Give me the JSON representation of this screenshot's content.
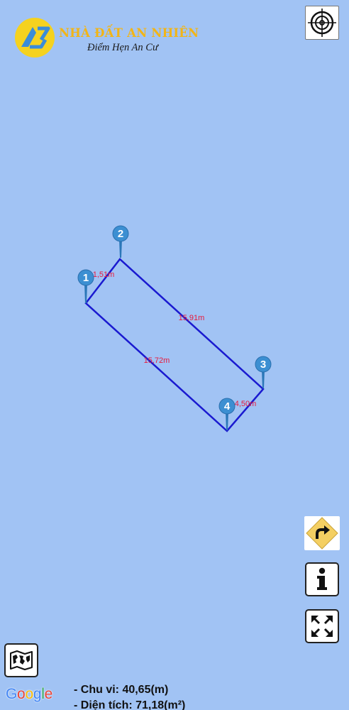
{
  "brand": {
    "name": "NHÀ ĐẤT AN NHIÊN",
    "slogan": "Điểm Hẹn An Cư",
    "logo_icon": "an-nhien-logo",
    "colors": {
      "circle": "#f5d21f",
      "mark": "#3a8cd8",
      "name": "#f2b516"
    }
  },
  "map": {
    "background": "#a1c3f4",
    "outline_color": "#1a1ad0",
    "label_color": "#e8193c",
    "markers": [
      {
        "label": "1"
      },
      {
        "label": "2"
      },
      {
        "label": "3"
      },
      {
        "label": "4"
      }
    ],
    "edges": [
      {
        "label": "1,51m"
      },
      {
        "label": "15,91m"
      },
      {
        "label": "4,50m"
      },
      {
        "label": "15,72m"
      }
    ]
  },
  "controls": {
    "locate_icon": "crosshair-icon",
    "direction_icon": "turn-right-sign-icon",
    "info_icon": "info-icon",
    "fullscreen_icon": "expand-arrows-icon",
    "maptype_icon": "map-icon"
  },
  "attribution": {
    "google": [
      "G",
      "o",
      "o",
      "g",
      "l",
      "e"
    ]
  },
  "stats": {
    "perimeter": "- Chu vi: 40,65(m)",
    "area": "- Diện tích: 71,18(m²)"
  }
}
